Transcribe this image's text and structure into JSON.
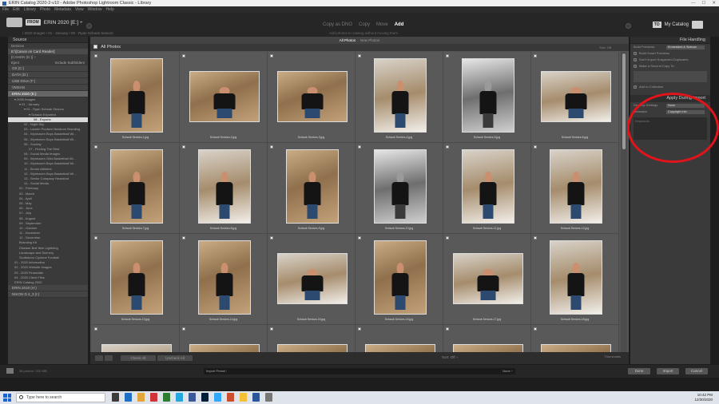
{
  "window": {
    "title": "ERIN Catalog 2020-2-v10 - Adobe Photoshop Lightroom Classic - Library",
    "controls": [
      "—",
      "☐",
      "✕"
    ]
  },
  "menu": [
    "File",
    "Edit",
    "Library",
    "Photo",
    "Metadata",
    "View",
    "Window",
    "Help"
  ],
  "header": {
    "from_label": "FROM",
    "source_name": "ERIN 2020 [E:] ÷",
    "source_sub": "/ 2020 Images / 01 - January / 05 - Ryan Schaub Seniors",
    "mode_tabs": [
      "Copy as DNG",
      "Copy",
      "Move",
      "Add"
    ],
    "mode_active": "Add",
    "mode_sub": "Add photos to catalog without moving them",
    "to_label": "TO",
    "to_name": "My Catalog"
  },
  "left_panel": {
    "title": "Source",
    "devices_label": "Devices",
    "device": "E:\\[Canon on Card Reader]",
    "device2": "[CANON (E:)] ÷",
    "eject_label": "Eject",
    "include_label": "Include Subfolders",
    "volumes": [
      {
        "label": "OS (C:)",
        "sel": false
      },
      {
        "label": "DATA (D:)",
        "sel": false
      },
      {
        "label": "USB Drive (F:)",
        "sel": false
      },
      {
        "label": "VMSAN",
        "sel": false
      },
      {
        "label": "ERIN 2020 (E:)",
        "sel": true
      }
    ],
    "tree": [
      {
        "text": "▾ 2020 Images",
        "indent": 8
      },
      {
        "text": "▾ 01 - January",
        "indent": 14
      },
      {
        "text": "▾ 01 - Ryan Schaub Seniors",
        "indent": 20
      },
      {
        "text": "▾ Schaub Exported",
        "indent": 26
      },
      {
        "text": "08 - Exports",
        "indent": 32,
        "sel": true
      },
      {
        "text": "02 - Night Sky",
        "indent": 20
      },
      {
        "text": "03 - Lauren Poulsen Newborn Branding",
        "indent": 20
      },
      {
        "text": "04 - Wynhaven Boys Basketball Wi...",
        "indent": 20
      },
      {
        "text": "05 - Wynhaven Boys Basketball Wi...",
        "indent": 20
      },
      {
        "text": "06 - Sunday",
        "indent": 20
      },
      {
        "text": "07 - Finding The Rest",
        "indent": 26
      },
      {
        "text": "08 - Social Media Images",
        "indent": 20
      },
      {
        "text": "09 - Wynhaven Girls Basketball Wi...",
        "indent": 20
      },
      {
        "text": "10 - Wynhaven Boys Basketball Wi...",
        "indent": 20
      },
      {
        "text": "11 - Senior Athletes",
        "indent": 20
      },
      {
        "text": "12 - Wynhaven Boys Basketball Wi...",
        "indent": 20
      },
      {
        "text": "13 - Senior Company Headshot",
        "indent": 20
      },
      {
        "text": "14 - Social Media",
        "indent": 20
      },
      {
        "text": "02 - February",
        "indent": 14
      },
      {
        "text": "03 - March",
        "indent": 14
      },
      {
        "text": "04 - April",
        "indent": 14
      },
      {
        "text": "05 - May",
        "indent": 14
      },
      {
        "text": "06 - June",
        "indent": 14
      },
      {
        "text": "07 - July",
        "indent": 14
      },
      {
        "text": "08 - August",
        "indent": 14
      },
      {
        "text": "09 - September",
        "indent": 14
      },
      {
        "text": "10 - October",
        "indent": 14
      },
      {
        "text": "11 - November",
        "indent": 14
      },
      {
        "text": "12 - December",
        "indent": 14
      },
      {
        "text": "Branding Kit",
        "indent": 14
      },
      {
        "text": "Disease Bolt Item Lightning",
        "indent": 14
      },
      {
        "text": "Landscape and Scenery",
        "indent": 14
      },
      {
        "text": "Scottsboro Cyclone Football",
        "indent": 14
      },
      {
        "text": "01 - 2020 Information",
        "indent": 8
      },
      {
        "text": "02 - 2020 Website Images",
        "indent": 8
      },
      {
        "text": "03 - 2020 Financials",
        "indent": 8
      },
      {
        "text": "04 - 2020 Client Files",
        "indent": 8
      },
      {
        "text": "ERIN Catalog 2020",
        "indent": 8
      }
    ],
    "volumes_bottom": [
      {
        "label": "ERIN 2018 (H:)",
        "sel": false
      },
      {
        "label": "NIKON D 4_3 (I:)",
        "sel": false
      }
    ]
  },
  "main": {
    "view_tabs": [
      "All Photos",
      "New Photos"
    ],
    "view_active": "All Photos",
    "grid_title": "All Photos",
    "sort_label": "Sort: Off",
    "thumbs": [
      {
        "file": "Schaub Seniors-1.jpg",
        "orient": "p",
        "tone": "warm"
      },
      {
        "file": "Schaub Seniors-2.jpg",
        "orient": "l",
        "tone": "warm"
      },
      {
        "file": "Schaub Seniors-3.jpg",
        "orient": "l",
        "tone": "warm"
      },
      {
        "file": "Schaub Seniors-4.jpg",
        "orient": "p",
        "tone": "snow"
      },
      {
        "file": "Schaub Seniors-5.jpg",
        "orient": "p",
        "tone": "bw"
      },
      {
        "file": "Schaub Seniors-6.jpg",
        "orient": "l",
        "tone": "snow"
      },
      {
        "file": "Schaub Seniors-7.jpg",
        "orient": "p",
        "tone": "warm"
      },
      {
        "file": "Schaub Seniors-8.jpg",
        "orient": "p",
        "tone": "snow"
      },
      {
        "file": "Schaub Seniors-9.jpg",
        "orient": "p",
        "tone": "warm"
      },
      {
        "file": "Schaub Seniors-10.jpg",
        "orient": "p",
        "tone": "bw"
      },
      {
        "file": "Schaub Seniors-11.jpg",
        "orient": "p",
        "tone": "snow"
      },
      {
        "file": "Schaub Seniors-12.jpg",
        "orient": "p",
        "tone": "snow"
      },
      {
        "file": "Schaub Seniors-13.jpg",
        "orient": "p",
        "tone": "warm"
      },
      {
        "file": "Schaub Seniors-14.jpg",
        "orient": "p",
        "tone": "warm"
      },
      {
        "file": "Schaub Seniors-15.jpg",
        "orient": "l",
        "tone": "snow"
      },
      {
        "file": "Schaub Seniors-16.jpg",
        "orient": "p",
        "tone": "warm"
      },
      {
        "file": "Schaub Seniors-17.jpg",
        "orient": "l",
        "tone": "snow"
      },
      {
        "file": "Schaub Seniors-18.jpg",
        "orient": "p",
        "tone": "snow"
      },
      {
        "file": "",
        "orient": "l",
        "tone": "snow"
      },
      {
        "file": "",
        "orient": "l",
        "tone": "warm"
      },
      {
        "file": "",
        "orient": "l",
        "tone": "warm"
      },
      {
        "file": "",
        "orient": "l",
        "tone": "warm"
      },
      {
        "file": "",
        "orient": "l",
        "tone": "warm"
      },
      {
        "file": "",
        "orient": "l",
        "tone": "warm"
      }
    ],
    "toolbar": {
      "check_all": "Check All",
      "uncheck_all": "Uncheck All",
      "sort": "Sort: Off ÷",
      "thumbnails": "Thumbnails"
    }
  },
  "right_panel": {
    "file_handling": "File Handling",
    "build_previews_label": "Build Previews",
    "build_previews_value": "Embedded & Sidecar",
    "checks": [
      "Build Smart Previews",
      "Don't Import Suspected Duplicates",
      "Make a Second Copy To:",
      "Add to Collection"
    ],
    "apply_title": "Apply During Import",
    "dev_settings_label": "Develop Settings",
    "dev_settings_value": "None",
    "metadata_label": "Metadata",
    "metadata_value": "Copyright Info",
    "keywords_label": "Keywords"
  },
  "bottom_bar": {
    "count": "36 photos / 100 MB",
    "preset_label": "Import Preset :",
    "preset_value": "None ÷",
    "done": "Done",
    "import": "Import",
    "cancel": "Cancel"
  },
  "taskbar": {
    "search_placeholder": "Type here to search",
    "time": "10:42 PM",
    "date": "12/30/2020",
    "app_colors": [
      "#3c3c3c",
      "#1f6fc4",
      "#e2a53a",
      "#d13438",
      "#2e7d32",
      "#26a6df",
      "#3b5998",
      "#001e36",
      "#31a8ff",
      "#c94f2e",
      "#f5c033",
      "#2b579a",
      "#777777"
    ]
  },
  "annotation_color": "#e0141a"
}
